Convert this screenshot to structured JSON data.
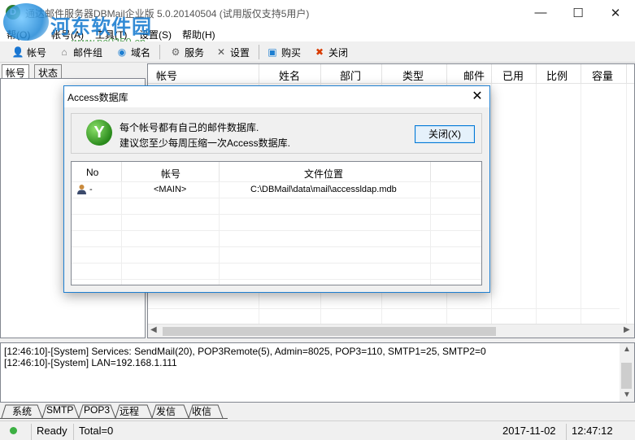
{
  "window": {
    "title": "通达邮件服务器DBMail企业版 5.0.20140504 (试用版仅支持5用户)",
    "controls": {
      "minimize": "—",
      "maximize": "☐",
      "close": "✕"
    }
  },
  "watermark": {
    "name": "河东软件园",
    "url": "www.pc0359.cn"
  },
  "menu": [
    "帮(O)",
    "帐号(A)",
    "工具(T)",
    "设置(S)",
    "帮助(H)"
  ],
  "toolbar": {
    "account": "帐号",
    "mail_group": "邮件组",
    "domain": "域名",
    "service": "服务",
    "settings": "设置",
    "buy": "购买",
    "close": "关闭"
  },
  "left_tabs": [
    "帐号",
    "状态"
  ],
  "grid": {
    "columns": [
      "帐号",
      "姓名",
      "部门",
      "类型",
      "邮件",
      "已用",
      "比例",
      "容量"
    ]
  },
  "log": {
    "lines": [
      "[12:46:10]-[System] Services: SendMail(20), POP3Remote(5), Admin=8025, POP3=110, SMTP1=25, SMTP2=0",
      "[12:46:10]-[System] LAN=192.168.1.111"
    ]
  },
  "bottom_tabs": [
    "系统",
    "SMTP",
    "POP3",
    "远程",
    "发信",
    "收信"
  ],
  "status": {
    "state": "Ready",
    "total": "Total=0",
    "date": "2017-11-02",
    "time": "12:47:12",
    "indicator_color": "#3cb043"
  },
  "dialog": {
    "title": "Access数据库",
    "message_line1": "每个帐号都有自己的邮件数据库.",
    "message_line2": "建议您至少每周压缩一次Access数据库.",
    "close_button": "关闭(X)",
    "columns": [
      "No",
      "帐号",
      "文件位置"
    ],
    "rows": [
      {
        "no": "-",
        "account": "<MAIN>",
        "path": "C:\\DBMail\\data\\mail\\accessldap.mdb"
      }
    ]
  },
  "colors": {
    "accent": "#0078d7",
    "watermark_blue": "#1e7fd1"
  }
}
